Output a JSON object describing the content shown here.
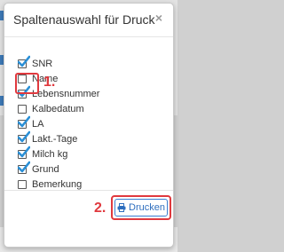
{
  "dialog": {
    "title": "Spaltenauswahl für Druck",
    "close_symbol": "×",
    "columns": [
      {
        "label": "SNR",
        "checked": true
      },
      {
        "label": "Name",
        "checked": false
      },
      {
        "label": "Lebensnummer",
        "checked": true
      },
      {
        "label": "Kalbedatum",
        "checked": false
      },
      {
        "label": "LA",
        "checked": true
      },
      {
        "label": "Lakt.-Tage",
        "checked": true
      },
      {
        "label": "Milch kg",
        "checked": true
      },
      {
        "label": "Grund",
        "checked": true
      },
      {
        "label": "Bemerkung",
        "checked": false
      }
    ],
    "print_button": {
      "label": "Drucken",
      "icon": "printer-icon"
    }
  },
  "annotations": {
    "step1": "1.",
    "step2": "2."
  },
  "colors": {
    "accent": "#2f6fbf",
    "check": "#2a8fd6",
    "annotation": "#e0393e"
  }
}
